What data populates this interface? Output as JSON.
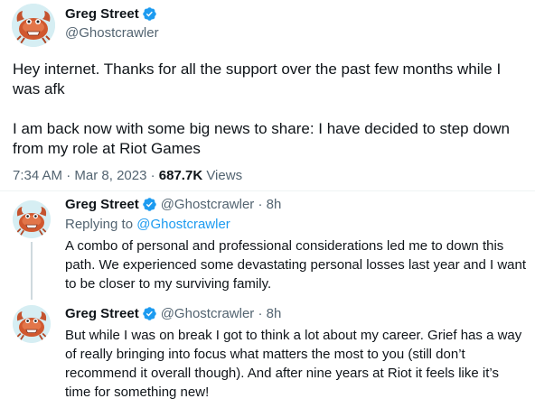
{
  "colors": {
    "accent": "#1d9bf0",
    "text": "#0f1419",
    "secondary": "#536471"
  },
  "tweet": {
    "display_name": "Greg Street",
    "handle": "@Ghostcrawler",
    "paragraphs": [
      "Hey internet. Thanks for all the support over the past few months while I was afk",
      "I am back now with some big news to share: I have decided to step down from my role at Riot Games"
    ],
    "time": "7:34 AM",
    "sep": " · ",
    "date": "Mar 8, 2023",
    "views_count": "687.7K",
    "views_label": " Views"
  },
  "replies": [
    {
      "display_name": "Greg Street",
      "handle_time": "@Ghostcrawler · 8h",
      "replying_prefix": "Replying to ",
      "replying_to": "@Ghostcrawler",
      "text": "A combo of personal and professional considerations led me to down this path. We experienced some devastating personal losses last year and I want to be closer to my surviving family."
    },
    {
      "display_name": "Greg Street",
      "handle_time": "@Ghostcrawler · 8h",
      "text": "But while I was on break I got to think a lot about my career. Grief has a way of really bringing into focus what matters the most to you (still don’t recommend it overall though). And after nine years at Riot it feels like it’s time for something new!"
    }
  ],
  "icons": {
    "verified": "verified-badge-icon",
    "avatar": "crab-avatar"
  }
}
